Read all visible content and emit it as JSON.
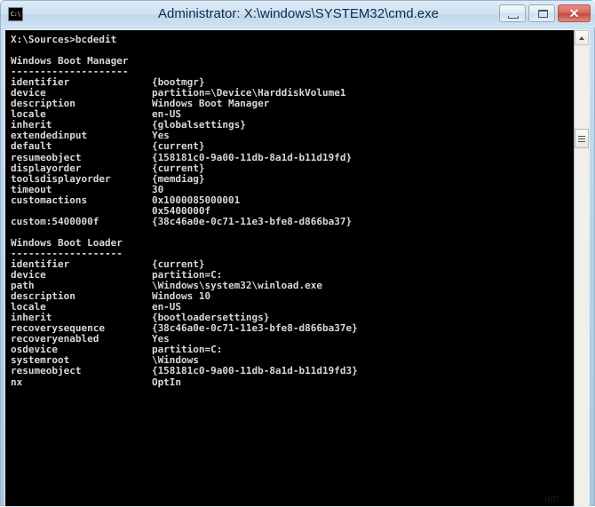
{
  "window": {
    "title": "Administrator: X:\\windows\\SYSTEM32\\cmd.exe",
    "icon_label": "C:\\",
    "icon_name": "cmd-icon",
    "controls": {
      "minimize_label": "–",
      "maximize_label": "□",
      "close_label": "✕"
    },
    "colors": {
      "titlebar_top": "#dcebf7",
      "titlebar_bottom": "#cfe3f3",
      "frame": "#b9d2e8",
      "console_bg": "#000000",
      "console_fg": "#d7d7d7",
      "close_button": "#c5483c"
    }
  },
  "scrollbar": {
    "up_arrow": "▲",
    "thumb_position_pct": 19
  },
  "watermark": {
    "text": "om"
  },
  "console": {
    "prompt_line": "X:\\Sources>bcdedit",
    "lines": [
      "X:\\Sources>bcdedit",
      "",
      "Windows Boot Manager",
      "--------------------",
      "identifier              {bootmgr}",
      "device                  partition=\\Device\\HarddiskVolume1",
      "description             Windows Boot Manager",
      "locale                  en-US",
      "inherit                 {globalsettings}",
      "extendedinput           Yes",
      "default                 {current}",
      "resumeobject            {158181c0-9a00-11db-8a1d-b11d19fd}",
      "displayorder            {current}",
      "toolsdisplayorder       {memdiag}",
      "timeout                 30",
      "customactions           0x1000085000001",
      "                        0x5400000f",
      "custom:5400000f         {38c46a0e-0c71-11e3-bfe8-d866ba37}",
      "",
      "Windows Boot Loader",
      "-------------------",
      "identifier              {current}",
      "device                  partition=C:",
      "path                    \\Windows\\system32\\winload.exe",
      "description             Windows 10",
      "locale                  en-US",
      "inherit                 {bootloadersettings}",
      "recoverysequence        {38c46a0e-0c71-11e3-bfe8-d866ba37e}",
      "recoveryenabled         Yes",
      "osdevice                partition=C:",
      "systemroot              \\Windows",
      "resumeobject            {158181c0-9a00-11db-8a1d-b11d19fd3}",
      "nx                      OptIn"
    ],
    "sections": [
      {
        "heading": "Windows Boot Manager",
        "underline": "--------------------",
        "entries": [
          {
            "key": "identifier",
            "value": "{bootmgr}"
          },
          {
            "key": "device",
            "value": "partition=\\Device\\HarddiskVolume1"
          },
          {
            "key": "description",
            "value": "Windows Boot Manager"
          },
          {
            "key": "locale",
            "value": "en-US"
          },
          {
            "key": "inherit",
            "value": "{globalsettings}"
          },
          {
            "key": "extendedinput",
            "value": "Yes"
          },
          {
            "key": "default",
            "value": "{current}"
          },
          {
            "key": "resumeobject",
            "value": "{158181c0-9a00-11db-8a1d-b11d19fd}"
          },
          {
            "key": "displayorder",
            "value": "{current}"
          },
          {
            "key": "toolsdisplayorder",
            "value": "{memdiag}"
          },
          {
            "key": "timeout",
            "value": "30"
          },
          {
            "key": "customactions",
            "value": "0x1000085000001"
          },
          {
            "key": "",
            "value": "0x5400000f"
          },
          {
            "key": "custom:5400000f",
            "value": "{38c46a0e-0c71-11e3-bfe8-d866ba37}"
          }
        ]
      },
      {
        "heading": "Windows Boot Loader",
        "underline": "-------------------",
        "entries": [
          {
            "key": "identifier",
            "value": "{current}"
          },
          {
            "key": "device",
            "value": "partition=C:"
          },
          {
            "key": "path",
            "value": "\\Windows\\system32\\winload.exe"
          },
          {
            "key": "description",
            "value": "Windows 10"
          },
          {
            "key": "locale",
            "value": "en-US"
          },
          {
            "key": "inherit",
            "value": "{bootloadersettings}"
          },
          {
            "key": "recoverysequence",
            "value": "{38c46a0e-0c71-11e3-bfe8-d866ba37e}"
          },
          {
            "key": "recoveryenabled",
            "value": "Yes"
          },
          {
            "key": "osdevice",
            "value": "partition=C:"
          },
          {
            "key": "systemroot",
            "value": "\\Windows"
          },
          {
            "key": "resumeobject",
            "value": "{158181c0-9a00-11db-8a1d-b11d19fd3}"
          },
          {
            "key": "nx",
            "value": "OptIn"
          }
        ]
      }
    ]
  }
}
